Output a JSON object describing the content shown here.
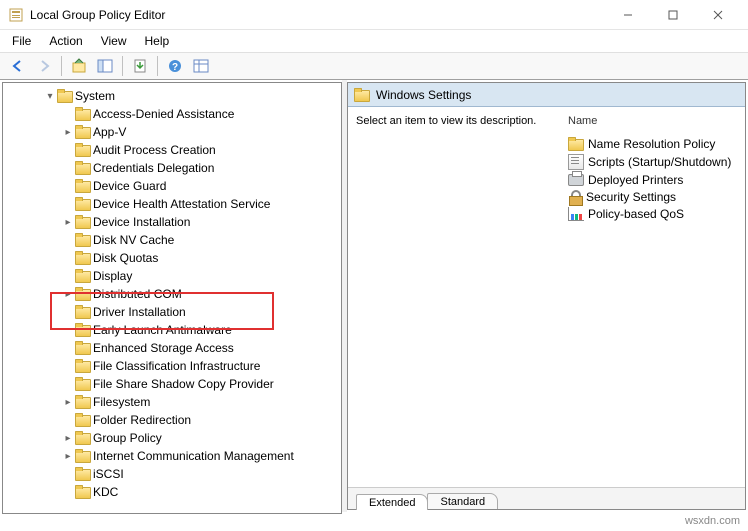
{
  "window": {
    "title": "Local Group Policy Editor"
  },
  "menubar": {
    "items": [
      "File",
      "Action",
      "View",
      "Help"
    ]
  },
  "tree": {
    "root": "System",
    "children": [
      "Access-Denied Assistance",
      "App-V",
      "Audit Process Creation",
      "Credentials Delegation",
      "Device Guard",
      "Device Health Attestation Service",
      "Device Installation",
      "Disk NV Cache",
      "Disk Quotas",
      "Display",
      "Distributed COM",
      "Driver Installation",
      "Early Launch Antimalware",
      "Enhanced Storage Access",
      "File Classification Infrastructure",
      "File Share Shadow Copy Provider",
      "Filesystem",
      "Folder Redirection",
      "Group Policy",
      "Internet Communication Management",
      "iSCSI",
      "KDC"
    ],
    "expandable": [
      "App-V",
      "Device Installation",
      "Distributed COM",
      "Filesystem",
      "Group Policy",
      "Internet Communication Management"
    ],
    "highlighted": "Driver Installation"
  },
  "right": {
    "header": "Windows Settings",
    "description": "Select an item to view its description.",
    "name_header": "Name",
    "items": [
      {
        "icon": "folder",
        "label": "Name Resolution Policy"
      },
      {
        "icon": "script",
        "label": "Scripts (Startup/Shutdown)"
      },
      {
        "icon": "printer",
        "label": "Deployed Printers"
      },
      {
        "icon": "lock",
        "label": "Security Settings"
      },
      {
        "icon": "chart",
        "label": "Policy-based QoS"
      }
    ]
  },
  "tabs": {
    "items": [
      "Extended",
      "Standard"
    ],
    "active": "Extended"
  },
  "watermark": "wsxdn.com"
}
